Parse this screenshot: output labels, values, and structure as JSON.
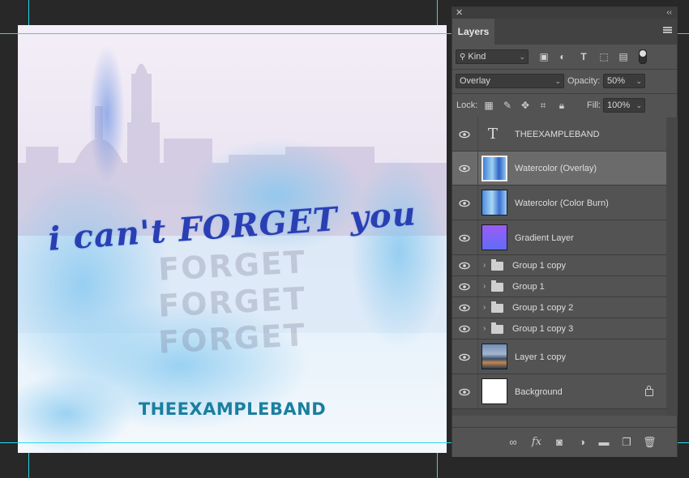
{
  "canvas": {
    "tagline": "i can't FORGET you",
    "echo": "FORGET",
    "band_name": "THEEXAMPLEBAND"
  },
  "panel": {
    "close": "✕",
    "collapse": "‹‹",
    "tab": "Layers",
    "filter_kind": "Kind",
    "blend_mode": "Overlay",
    "opacity_label": "Opacity:",
    "opacity_value": "50%",
    "lock_label": "Lock:",
    "fill_label": "Fill:",
    "fill_value": "100%",
    "layers": [
      {
        "name": "THEEXAMPLEBAND",
        "type": "text"
      },
      {
        "name": "Watercolor (Overlay)",
        "type": "image",
        "selected": true
      },
      {
        "name": "Watercolor (Color Burn)",
        "type": "image"
      },
      {
        "name": "Gradient Layer",
        "type": "gradient"
      },
      {
        "name": "Group 1 copy",
        "type": "group"
      },
      {
        "name": "Group 1",
        "type": "group"
      },
      {
        "name": "Group 1 copy 2",
        "type": "group"
      },
      {
        "name": "Group 1 copy 3",
        "type": "group"
      },
      {
        "name": "Layer 1 copy",
        "type": "image"
      },
      {
        "name": "Background",
        "type": "background",
        "locked": true
      }
    ],
    "text_layer_glyph": "T",
    "footer_fx": "fx"
  },
  "colors": {
    "app_bg": "#282828",
    "guide": "#28d9ea",
    "panel_bg": "#535353",
    "selected_row": "#6b6b6b",
    "tagline": "#2a3fb2",
    "band": "#1a7fa0"
  }
}
